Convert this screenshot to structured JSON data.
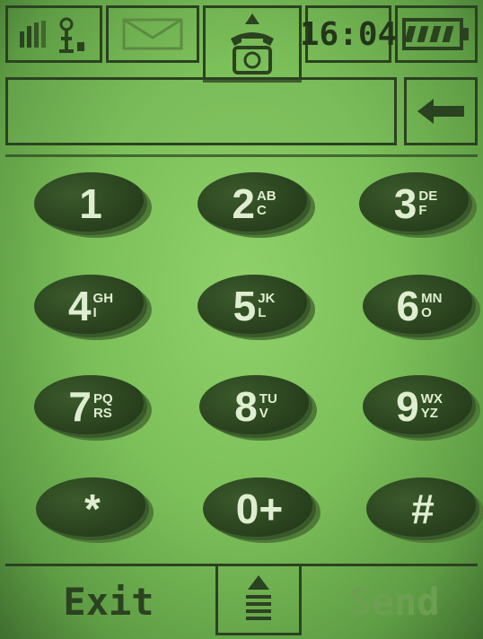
{
  "status_bar": {
    "signal_icon": "signal-antenna-icon",
    "message_icon": "envelope-icon",
    "call_icon": "telephone-icon",
    "time": "16:04",
    "battery_icon": "battery-icon"
  },
  "input": {
    "value": "",
    "backspace_icon": "backspace-arrow-icon"
  },
  "keypad": {
    "keys": [
      {
        "digit": "1",
        "letters": [
          "",
          ""
        ]
      },
      {
        "digit": "2",
        "letters": [
          "AB",
          "C"
        ]
      },
      {
        "digit": "3",
        "letters": [
          "DE",
          "F"
        ]
      },
      {
        "digit": "4",
        "letters": [
          "GH",
          "I"
        ]
      },
      {
        "digit": "5",
        "letters": [
          "JK",
          "L"
        ]
      },
      {
        "digit": "6",
        "letters": [
          "MN",
          "O"
        ]
      },
      {
        "digit": "7",
        "letters": [
          "PQ",
          "RS"
        ]
      },
      {
        "digit": "8",
        "letters": [
          "TU",
          "V"
        ]
      },
      {
        "digit": "9",
        "letters": [
          "WX",
          "YZ"
        ]
      },
      {
        "digit": "*",
        "letters": [
          "",
          ""
        ]
      },
      {
        "digit": "0+",
        "letters": [
          "",
          ""
        ]
      },
      {
        "digit": "#",
        "letters": [
          "",
          ""
        ]
      }
    ]
  },
  "softkeys": {
    "left": "Exit",
    "center_icon": "menu-up-icon",
    "right": "Send"
  },
  "colors": {
    "lcd_bg": "#7cc05a",
    "lcd_ink": "#24361a",
    "key_fill": "#263d1b",
    "key_text": "#dfeed0"
  }
}
